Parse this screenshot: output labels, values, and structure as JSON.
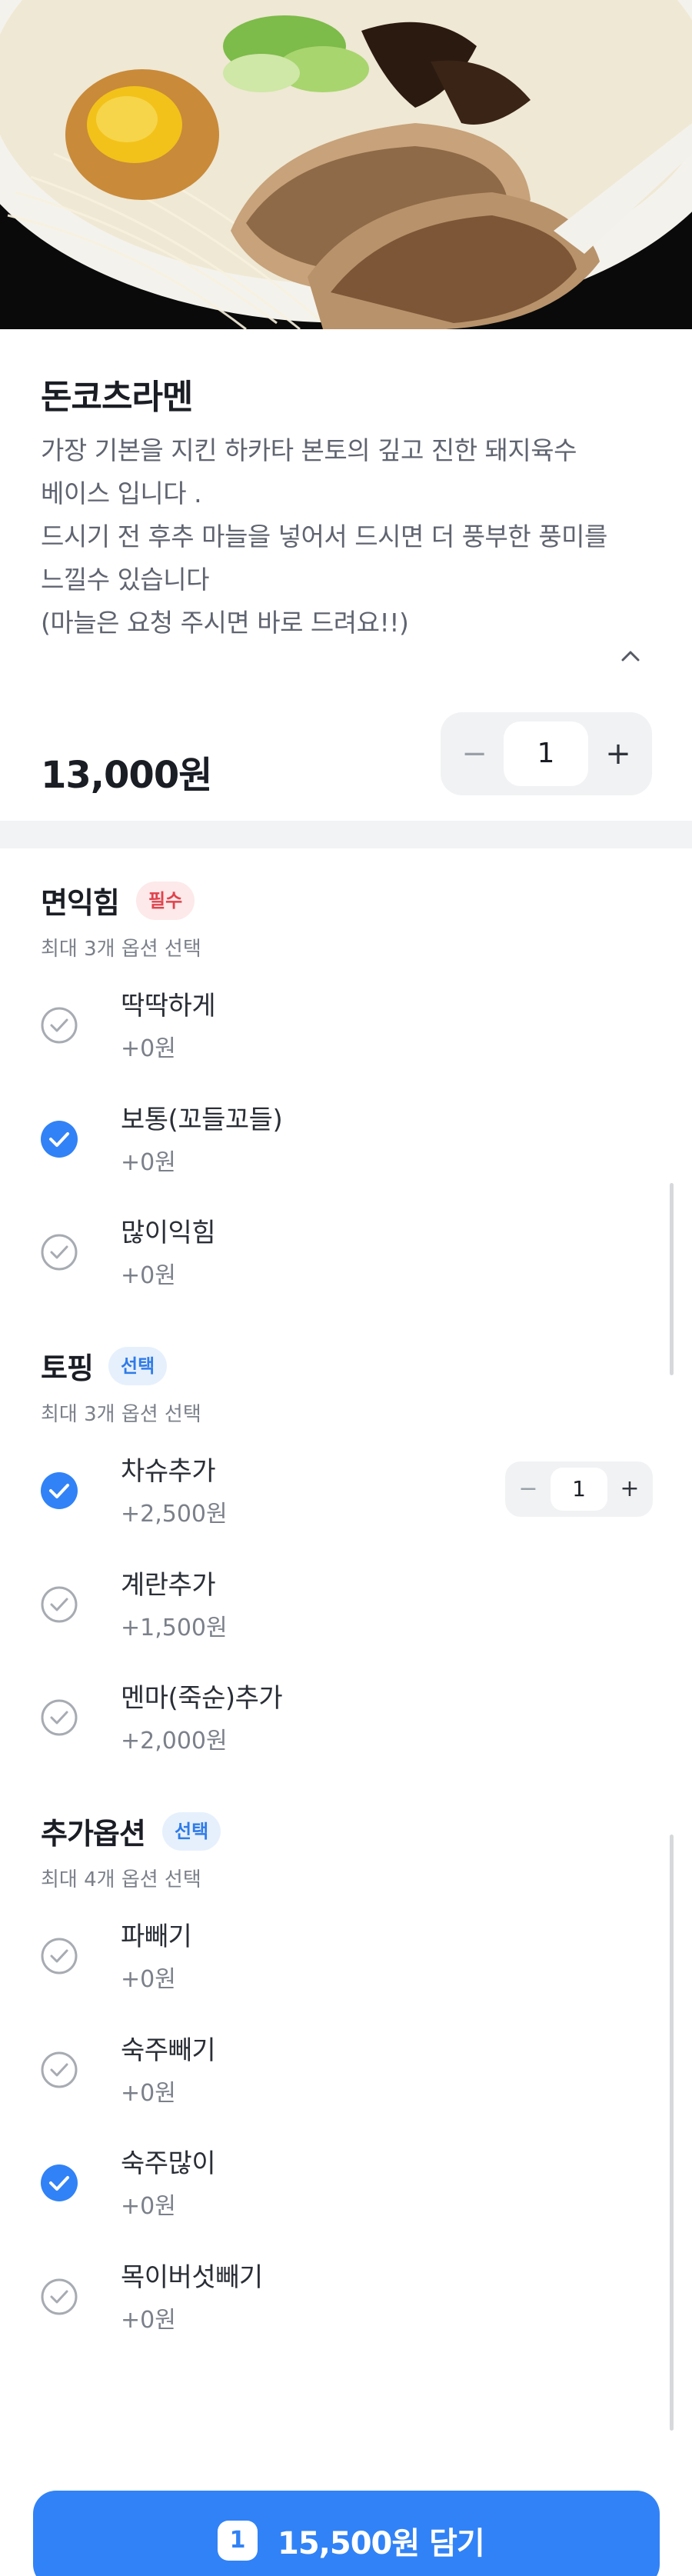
{
  "menu": {
    "title": "돈코츠라멘",
    "description_lines": [
      "가장 기본을 지킨 하카타 본토의 깊고 진한 돼지육수",
      "베이스 입니다 .",
      "드시기 전 후추 마늘을 넣어서 드시면 더 풍부한 풍미를",
      "느낄수 있습니다",
      "(마늘은 요청 주시면 바로 드려요!!)"
    ],
    "price": "13,000원",
    "quantity": "1"
  },
  "sections": [
    {
      "title": "면익힘",
      "badge": "필수",
      "subtitle": "최대 3개 옵션 선택",
      "options": [
        {
          "name": "딱딱하게",
          "price": "+0원",
          "checked": false
        },
        {
          "name": "보통(꼬들꼬들)",
          "price": "+0원",
          "checked": true
        },
        {
          "name": "많이익힘",
          "price": "+0원",
          "checked": false
        }
      ]
    },
    {
      "title": "토핑",
      "badge": "선택",
      "subtitle": "최대 3개 옵션 선택",
      "options": [
        {
          "name": "차슈추가",
          "price": "+2,500원",
          "checked": true,
          "quantity": "1"
        },
        {
          "name": "계란추가",
          "price": "+1,500원",
          "checked": false
        },
        {
          "name": "멘마(죽순)추가",
          "price": "+2,000원",
          "checked": false
        }
      ]
    },
    {
      "title": "추가옵션",
      "badge": "선택",
      "subtitle": "최대 4개 옵션 선택",
      "options": [
        {
          "name": "파빼기",
          "price": "+0원",
          "checked": false
        },
        {
          "name": "숙주빼기",
          "price": "+0원",
          "checked": false
        },
        {
          "name": "숙주많이",
          "price": "+0원",
          "checked": true
        },
        {
          "name": "목이버섯빼기",
          "price": "+0원",
          "checked": false
        }
      ]
    }
  ],
  "cart_button": {
    "count": "1",
    "label": "15,500원 담기"
  },
  "colors": {
    "accent": "#3182f6",
    "required_badge": "#e0434d",
    "optional_badge": "#2f7be8"
  },
  "icons": {
    "check_on": "check-circle-filled-icon",
    "check_off": "check-circle-outline-icon",
    "collapse": "chevron-up-icon"
  }
}
